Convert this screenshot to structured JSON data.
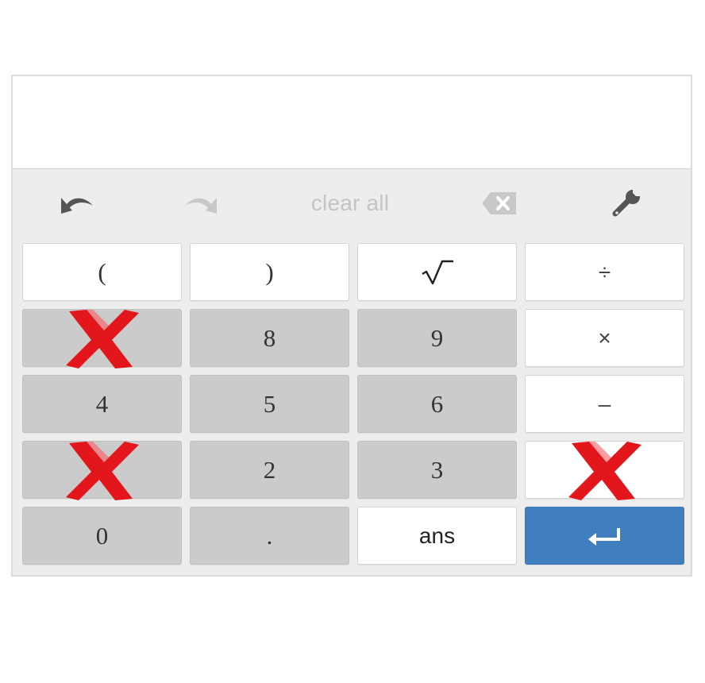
{
  "toolbar": {
    "undo_icon": "undo-icon",
    "redo_icon": "redo-icon",
    "clear_all_label": "clear all",
    "backspace_icon": "backspace-icon",
    "settings_icon": "wrench-icon"
  },
  "keys": {
    "open_paren": "(",
    "close_paren": ")",
    "sqrt": "√",
    "divide": "÷",
    "eight": "8",
    "nine": "9",
    "multiply": "×",
    "four": "4",
    "five": "5",
    "six": "6",
    "minus": "–",
    "two": "2",
    "three": "3",
    "zero": "0",
    "decimal": ".",
    "ans": "ans",
    "enter_icon": "enter-icon"
  },
  "obscured_keys": [
    "row2-col1",
    "row4-col1",
    "row4-col4"
  ],
  "colors": {
    "enter_key": "#3f7fbf",
    "gray_key": "#cbcbcb",
    "white_key": "#ffffff",
    "x_mark": "#e3161c"
  }
}
